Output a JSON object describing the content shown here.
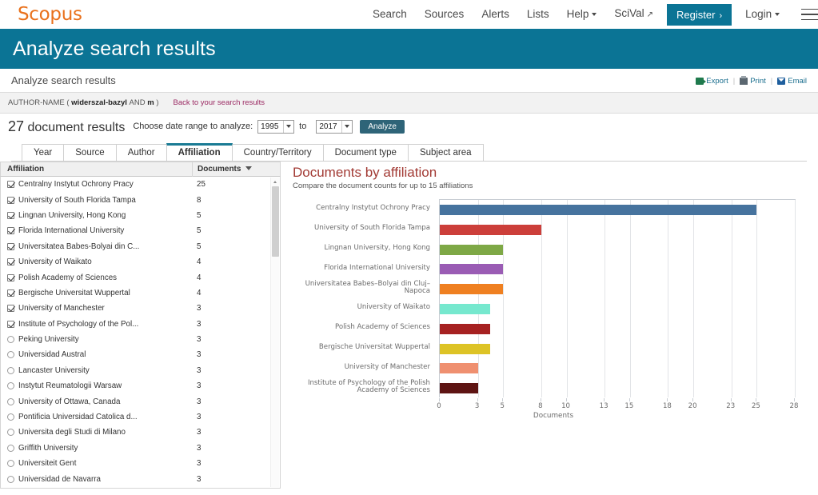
{
  "brand": {
    "name": "Scopus",
    "color": "#e9711c"
  },
  "topnav": {
    "links": [
      {
        "label": "Search",
        "caret": false,
        "ext": false
      },
      {
        "label": "Sources",
        "caret": false,
        "ext": false
      },
      {
        "label": "Alerts",
        "caret": false,
        "ext": false
      },
      {
        "label": "Lists",
        "caret": false,
        "ext": false
      },
      {
        "label": "Help",
        "caret": true,
        "ext": false
      },
      {
        "label": "SciVal",
        "caret": false,
        "ext": true
      }
    ],
    "register_label": "Register",
    "register_arrow": "›",
    "login_label": "Login",
    "menu_icon": "hamburger-icon"
  },
  "banner": {
    "title": "Analyze search results",
    "color": "#0b7495"
  },
  "subheader": {
    "page_title": "Analyze search results",
    "actions": [
      {
        "label": "Export",
        "icon": "export-icon"
      },
      {
        "label": "Print",
        "icon": "print-icon"
      },
      {
        "label": "Email",
        "icon": "email-icon"
      }
    ],
    "separator": "|"
  },
  "query_bar": {
    "prefix": "AUTHOR-NAME (",
    "term": "widerszal-bazyl",
    "operator": "AND",
    "term2": "m",
    "suffix": ")",
    "back_link": "Back to your search results"
  },
  "analyze_row": {
    "count": "27",
    "count_label": "document results",
    "date_label": "Choose date range to analyze:",
    "year_from": "1995",
    "to_word": "to",
    "year_to": "2017",
    "analyze_button": "Analyze"
  },
  "tabs": [
    {
      "label": "Year",
      "active": false
    },
    {
      "label": "Source",
      "active": false
    },
    {
      "label": "Author",
      "active": false
    },
    {
      "label": "Affiliation",
      "active": true
    },
    {
      "label": "Country/Territory",
      "active": false
    },
    {
      "label": "Document type",
      "active": false
    },
    {
      "label": "Subject area",
      "active": false
    }
  ],
  "list": {
    "columns": [
      "Affiliation",
      "Documents"
    ],
    "sort_icon": "sort-descending-icon",
    "rows": [
      {
        "name": "Centralny Instytut Ochrony Pracy",
        "docs": "25",
        "checked": true
      },
      {
        "name": "University of South Florida Tampa",
        "docs": "8",
        "checked": true
      },
      {
        "name": "Lingnan University, Hong Kong",
        "docs": "5",
        "checked": true
      },
      {
        "name": "Florida International University",
        "docs": "5",
        "checked": true
      },
      {
        "name": "Universitatea Babes-Bolyai din C...",
        "docs": "5",
        "checked": true
      },
      {
        "name": "University of Waikato",
        "docs": "4",
        "checked": true
      },
      {
        "name": "Polish Academy of Sciences",
        "docs": "4",
        "checked": true
      },
      {
        "name": "Bergische Universitat Wuppertal",
        "docs": "4",
        "checked": true
      },
      {
        "name": "University of Manchester",
        "docs": "3",
        "checked": true
      },
      {
        "name": "Institute of Psychology of the Pol...",
        "docs": "3",
        "checked": true
      },
      {
        "name": "Peking University",
        "docs": "3",
        "checked": false
      },
      {
        "name": "Universidad Austral",
        "docs": "3",
        "checked": false
      },
      {
        "name": "Lancaster University",
        "docs": "3",
        "checked": false
      },
      {
        "name": "Instytut Reumatologii Warsaw",
        "docs": "3",
        "checked": false
      },
      {
        "name": "University of Ottawa, Canada",
        "docs": "3",
        "checked": false
      },
      {
        "name": "Pontificia Universidad Catolica d...",
        "docs": "3",
        "checked": false
      },
      {
        "name": "Universita degli Studi di Milano",
        "docs": "3",
        "checked": false
      },
      {
        "name": "Griffith University",
        "docs": "3",
        "checked": false
      },
      {
        "name": "Universiteit Gent",
        "docs": "3",
        "checked": false
      },
      {
        "name": "Universidad de Navarra",
        "docs": "3",
        "checked": false
      }
    ]
  },
  "chart_data": {
    "type": "bar",
    "orientation": "horizontal",
    "title": "Documents by affiliation",
    "subtitle": "Compare the document counts for up to 15 affiliations",
    "xlabel": "Documents",
    "ylabel": "",
    "xlim": [
      0,
      28
    ],
    "xticks": [
      0,
      3,
      5,
      8,
      10,
      13,
      15,
      18,
      20,
      23,
      25,
      28
    ],
    "grid": true,
    "legend": "none",
    "categories": [
      "Centralny Instytut Ochrony Pracy",
      "University of South Florida Tampa",
      "Lingnan University, Hong Kong",
      "Florida International University",
      "Universitatea Babes–Bolyai din Cluj–Napoca",
      "University of Waikato",
      "Polish Academy of Sciences",
      "Bergische Universitat Wuppertal",
      "University of Manchester",
      "Institute of Psychology of the Polish Academy of Sciences"
    ],
    "values": [
      25,
      8,
      5,
      5,
      5,
      4,
      4,
      4,
      3,
      3
    ],
    "colors": [
      "#46739e",
      "#cc3f3a",
      "#7ba councils"
    ],
    "bar_colors": [
      "#46739e",
      "#cc3f3a",
      "#7ea846",
      "#9a5cb4",
      "#ef8021",
      "#76e8ce",
      "#a62121",
      "#ddc326",
      "#ef9070",
      "#5e1413"
    ]
  }
}
